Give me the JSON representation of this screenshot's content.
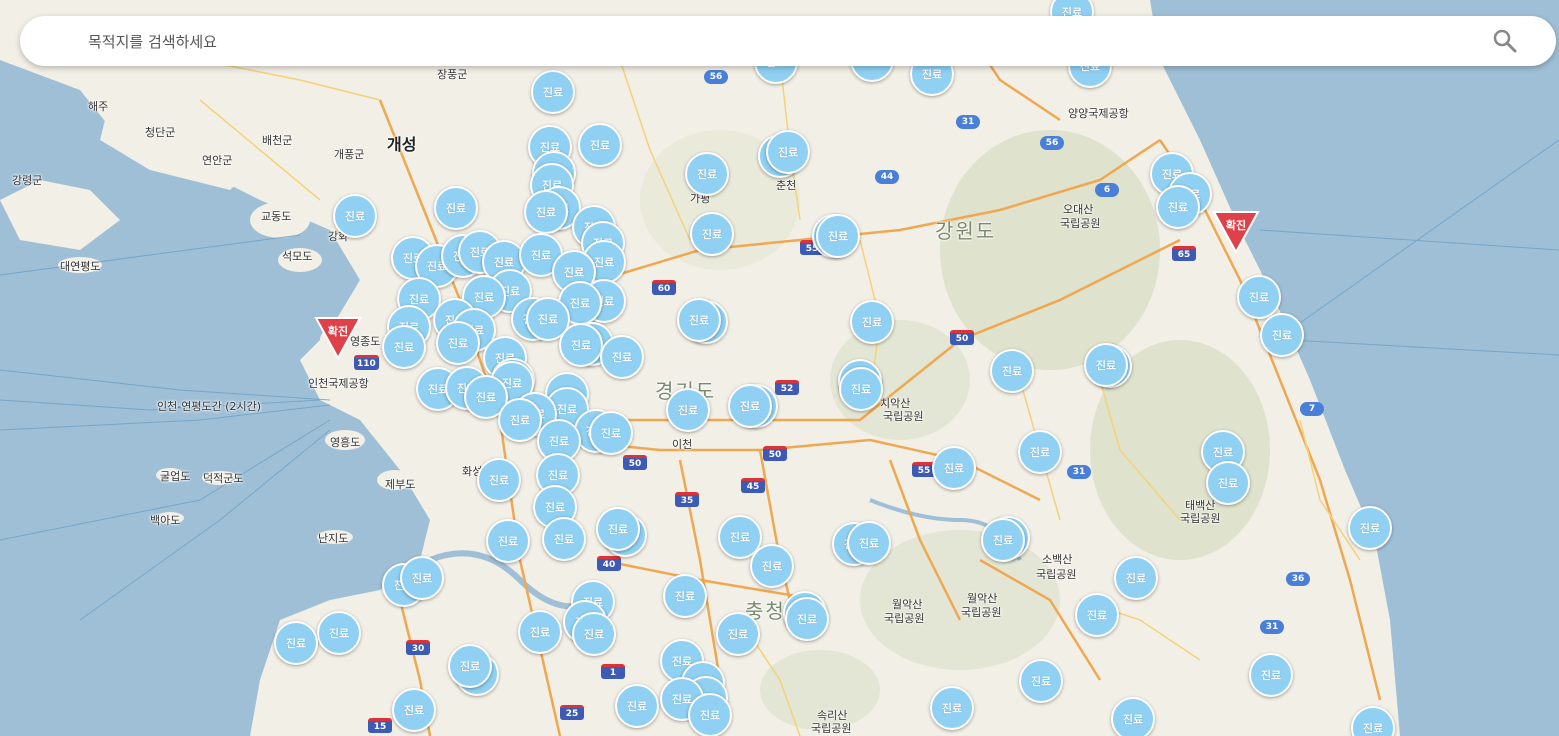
{
  "search": {
    "placeholder": "목적지를 검색하세요",
    "value": ""
  },
  "legend_colors": {
    "clinic": "#8fd0f3",
    "confirmed": "#e04048"
  },
  "marker_label": "진료",
  "confirmed_label": "확진",
  "place_labels": [
    "해주",
    "청단군",
    "배천군",
    "연안군",
    "강령군",
    "개풍군",
    "장풍군",
    "개성",
    "교동도",
    "석모도",
    "대연평도",
    "강화",
    "영종도",
    "인천국제공항",
    "영흥도",
    "제부도",
    "굴업도",
    "덕적군도",
    "백아도",
    "난지도",
    "화성",
    "양양국제공항",
    "오대산",
    "국립공원",
    "강원도",
    "치악산",
    "국립공원",
    "이천",
    "경기도",
    "춘천",
    "가평",
    "태백산",
    "국립공원",
    "소백산",
    "국립공원",
    "월악산",
    "국립공원",
    "월악산",
    "국립공원",
    "속리산",
    "국립공원",
    "충청북도",
    "인천-연평도간 (2시간)"
  ],
  "road_numbers": [
    "56",
    "31",
    "56",
    "44",
    "6",
    "65",
    "60",
    "55",
    "50",
    "52",
    "50",
    "50",
    "45",
    "35",
    "40",
    "30",
    "1",
    "25",
    "15",
    "55",
    "31",
    "7",
    "36",
    "31",
    "110"
  ]
}
